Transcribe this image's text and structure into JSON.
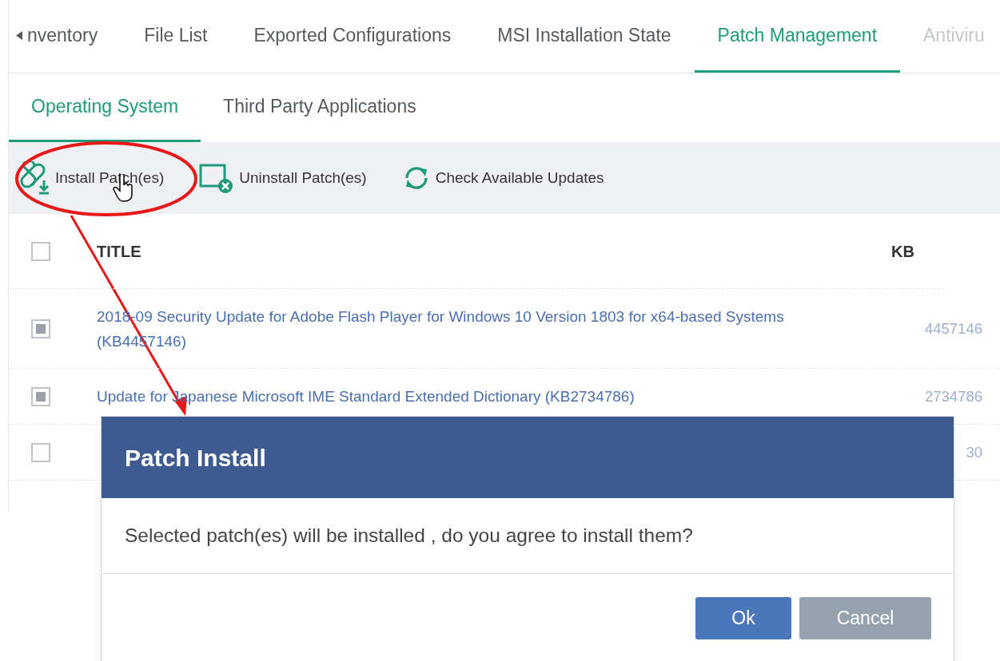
{
  "tabs": [
    {
      "label": "nventory",
      "selected": false,
      "kind": "scrolled"
    },
    {
      "label": "File List",
      "selected": false,
      "kind": "normal"
    },
    {
      "label": "Exported Configurations",
      "selected": false,
      "kind": "normal"
    },
    {
      "label": "MSI Installation State",
      "selected": false,
      "kind": "normal"
    },
    {
      "label": "Patch Management",
      "selected": true,
      "kind": "normal"
    },
    {
      "label": "Antiviru",
      "selected": false,
      "kind": "faded"
    }
  ],
  "subtabs": [
    {
      "label": "Operating System",
      "selected": true
    },
    {
      "label": "Third Party Applications",
      "selected": false
    }
  ],
  "toolbar": [
    {
      "label": "Install Patch(es)",
      "kind": "install"
    },
    {
      "label": "Uninstall Patch(es)",
      "kind": "uninstall"
    },
    {
      "label": "Check Available Updates",
      "kind": "refresh"
    }
  ],
  "table": {
    "columns": [
      "TITLE",
      "KB"
    ],
    "header_checked": false,
    "rows": [
      {
        "title": "2018-09 Security Update for Adobe Flash Player for Windows 10 Version 1803 for x64-based Systems (KB4457146)",
        "kb": "4457146",
        "checked": true
      },
      {
        "title": "Update for Japanese Microsoft IME Standard Extended Dictionary (KB2734786)",
        "kb": "2734786",
        "checked": true
      },
      {
        "kb": "30",
        "checked": false
      }
    ]
  },
  "dialog": {
    "title": "Patch Install",
    "message": "Selected patch(es) will be installed , do you agree to install them?",
    "buttons": [
      {
        "label": "Ok",
        "kind": "primary"
      },
      {
        "label": "Cancel",
        "kind": "secondary"
      }
    ]
  }
}
